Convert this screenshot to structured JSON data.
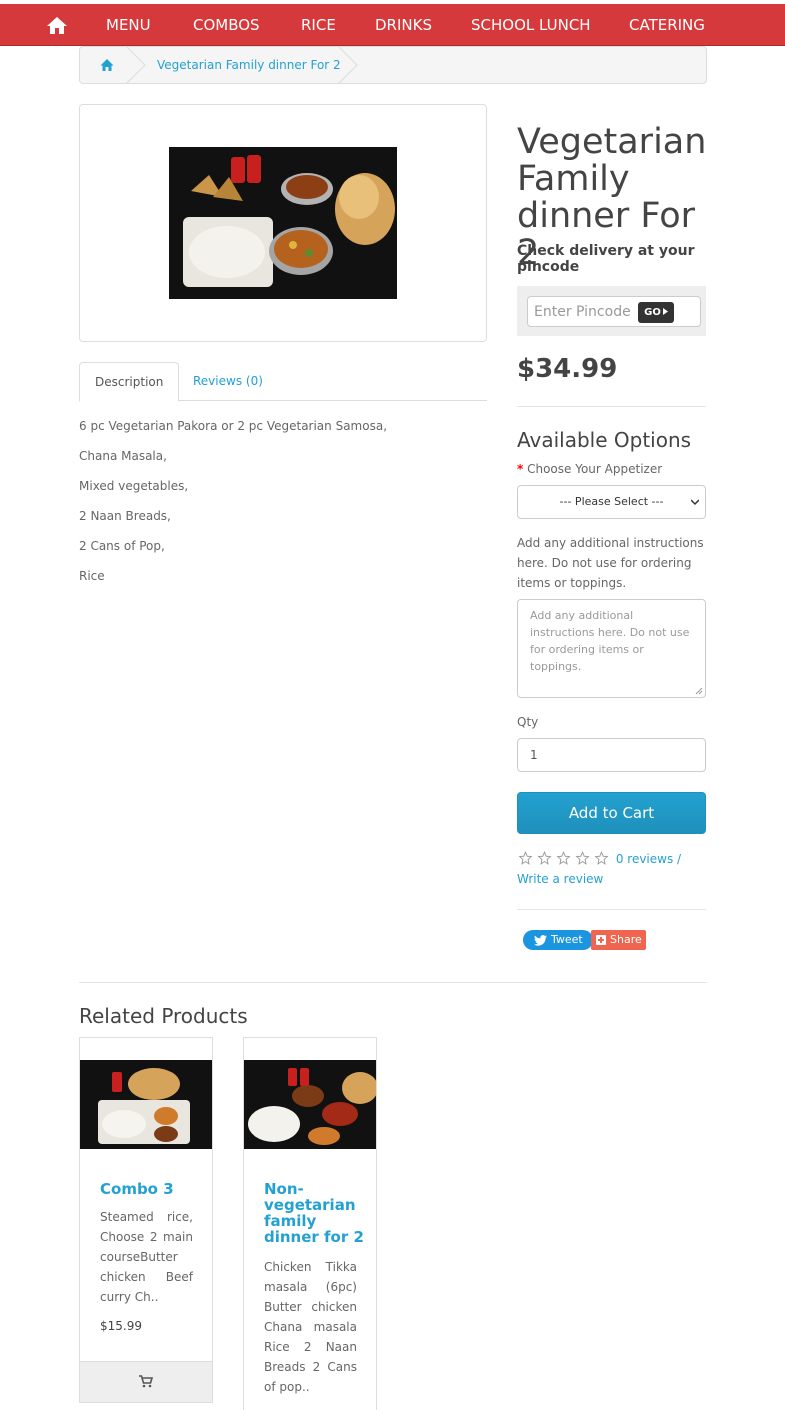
{
  "nav": {
    "home_icon": "home-icon",
    "items": [
      "MENU",
      "COMBOS",
      "RICE",
      "DRINKS",
      "SCHOOL LUNCH",
      "CATERING"
    ]
  },
  "breadcrumb": {
    "home_icon": "home-icon",
    "current": "Vegetarian Family dinner For 2"
  },
  "product": {
    "title": "Vegetarian Family dinner For 2",
    "price": "$34.99",
    "image": "vegetarian-family-dinner-photo"
  },
  "tabs": [
    {
      "label": "Description",
      "active": true
    },
    {
      "label": "Reviews (0)",
      "active": false
    }
  ],
  "description": [
    "6 pc Vegetarian Pakora or 2 pc Vegetarian Samosa,",
    "Chana Masala,",
    "Mixed vegetables,",
    "2 Naan Breads,",
    "2 Cans of Pop,",
    "Rice"
  ],
  "pincode": {
    "heading": "Check delivery at your pincode",
    "placeholder": "Enter Pincode",
    "button": "GO"
  },
  "options": {
    "heading": "Available Options",
    "required_mark": "*",
    "appetizer_label": "Choose Your Appetizer",
    "appetizer_selected": "--- Please Select ---",
    "instructions_label": "Add any additional instructions here. Do not use for ordering items or toppings.",
    "instructions_placeholder": "Add any additional instructions here. Do not use for ordering items or toppings.",
    "qty_label": "Qty",
    "qty_value": "1",
    "add_to_cart": "Add to Cart"
  },
  "rating": {
    "stars": 0,
    "max_stars": 5,
    "reviews_link": "0 reviews",
    "separator": "/",
    "write_link": "Write a review"
  },
  "social": {
    "tweet": "Tweet",
    "share": "Share"
  },
  "related": {
    "heading": "Related Products",
    "products": [
      {
        "name": "Combo 3",
        "description": "Steamed rice, Choose 2 main courseButter chicken Beef curry Ch..",
        "price": "$15.99",
        "image": "combo-3-photo"
      },
      {
        "name": "Non-vegetarian family dinner for 2",
        "description": "Chicken Tikka masala (6pc) Butter chicken Chana masala Rice 2 Naan Breads 2 Cans of pop..",
        "price": "",
        "image": "non-veg-family-dinner-photo"
      }
    ]
  },
  "colors": {
    "nav_red": "#d6393b",
    "link_blue": "#23a1d1",
    "cart_blue": "#1f90bb",
    "tweet_blue": "#1b95e0",
    "share_orange": "#f0654f"
  }
}
